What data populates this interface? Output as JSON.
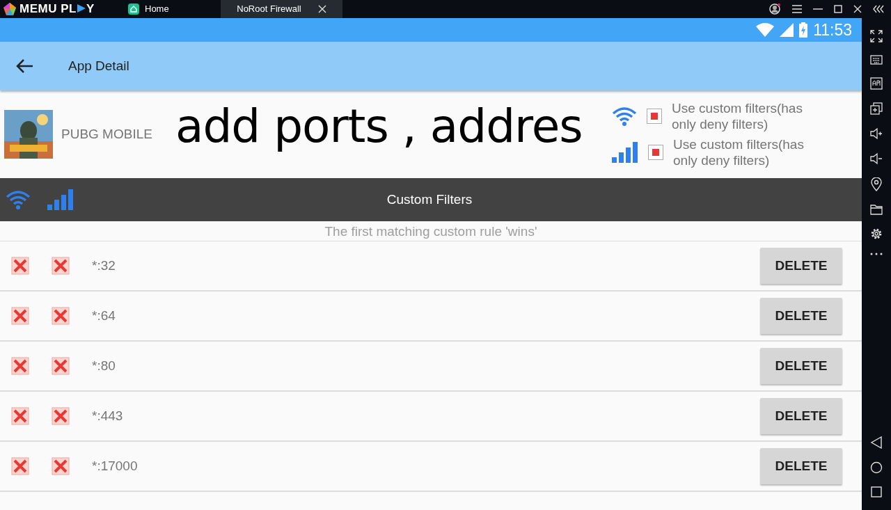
{
  "emulator": {
    "logo": [
      "MEMU PL",
      "Y"
    ],
    "tabs": [
      {
        "label": "Home",
        "selected": false
      },
      {
        "label": "NoRoot Firewall",
        "selected": true
      }
    ]
  },
  "status_bar": {
    "time": "11:53"
  },
  "app_bar": {
    "title": "App Detail"
  },
  "app": {
    "name": "PUBG MOBILE"
  },
  "annotation": "add ports , addres",
  "network_options": [
    {
      "kind": "wifi",
      "label": "Use custom filters(has only deny filters)",
      "checked": true
    },
    {
      "kind": "mobile",
      "label": "Use custom filters(has only deny filters)",
      "checked": true
    }
  ],
  "filters_header": {
    "title": "Custom Filters"
  },
  "hint": "The first matching custom rule 'wins'",
  "rules": [
    {
      "address": "*:32",
      "wifi_blocked": true,
      "mobile_blocked": true,
      "action": "DELETE"
    },
    {
      "address": "*:64",
      "wifi_blocked": true,
      "mobile_blocked": true,
      "action": "DELETE"
    },
    {
      "address": "*:80",
      "wifi_blocked": true,
      "mobile_blocked": true,
      "action": "DELETE"
    },
    {
      "address": "*:443",
      "wifi_blocked": true,
      "mobile_blocked": true,
      "action": "DELETE"
    },
    {
      "address": "*:17000",
      "wifi_blocked": true,
      "mobile_blocked": true,
      "action": "DELETE"
    }
  ]
}
